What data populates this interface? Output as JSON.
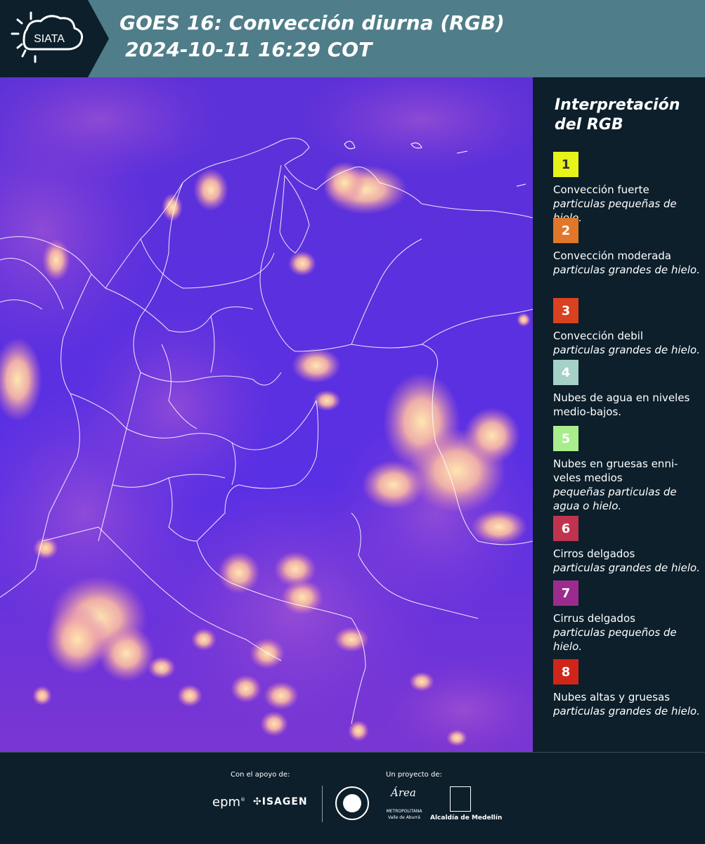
{
  "header": {
    "logo_text": "SIATA",
    "title_line1": "GOES 16: Convección diurna (RGB)",
    "title_line2": "2024-10-11 16:29 COT"
  },
  "legend": {
    "title_line1": "Interpretación",
    "title_line2": "del RGB",
    "items": [
      {
        "num": "1",
        "color": "#e8f31a",
        "text_color": "#333333",
        "line1": "Convección fuerte",
        "line2": "particulas pequeñas de hielo."
      },
      {
        "num": "2",
        "color": "#e0772b",
        "text_color": "#ffffff",
        "line1": "Convección moderada",
        "line2": "particulas grandes de hielo."
      },
      {
        "num": "3",
        "color": "#d9411f",
        "text_color": "#ffffff",
        "line1": "Convección debil",
        "line2": "particulas grandes de hielo."
      },
      {
        "num": "4",
        "color": "#a5d1c8",
        "text_color": "#ffffff",
        "line1": "Nubes de agua en niveles medio-bajos.",
        "line2": ""
      },
      {
        "num": "5",
        "color": "#a9ed8c",
        "text_color": "#ffffff",
        "line1": "Nubes en gruesas enni-veles medios",
        "line2": "pequeñas particulas de agua o hielo."
      },
      {
        "num": "6",
        "color": "#c0334f",
        "text_color": "#ffffff",
        "line1": "Cirros delgados",
        "line2": "particulas grandes de hielo."
      },
      {
        "num": "7",
        "color": "#9b2c8e",
        "text_color": "#ffffff",
        "line1": "Cirrus delgados",
        "line2": "particulas pequeños de hielo."
      },
      {
        "num": "8",
        "color": "#d2251a",
        "text_color": "#ffffff",
        "line1": "Nubes altas y gruesas",
        "line2": "particulas grandes de hielo."
      }
    ]
  },
  "footer": {
    "support_label": "Con el apoyo de:",
    "project_label": "Un proyecto de:",
    "sponsor1": "epm",
    "sponsor2": "ISAGEN",
    "org2_line1": "Área",
    "org2_line2": "METROPOLITANA",
    "org2_line3": "Valle de Aburrá",
    "org3": "Alcaldía de Medellín"
  }
}
